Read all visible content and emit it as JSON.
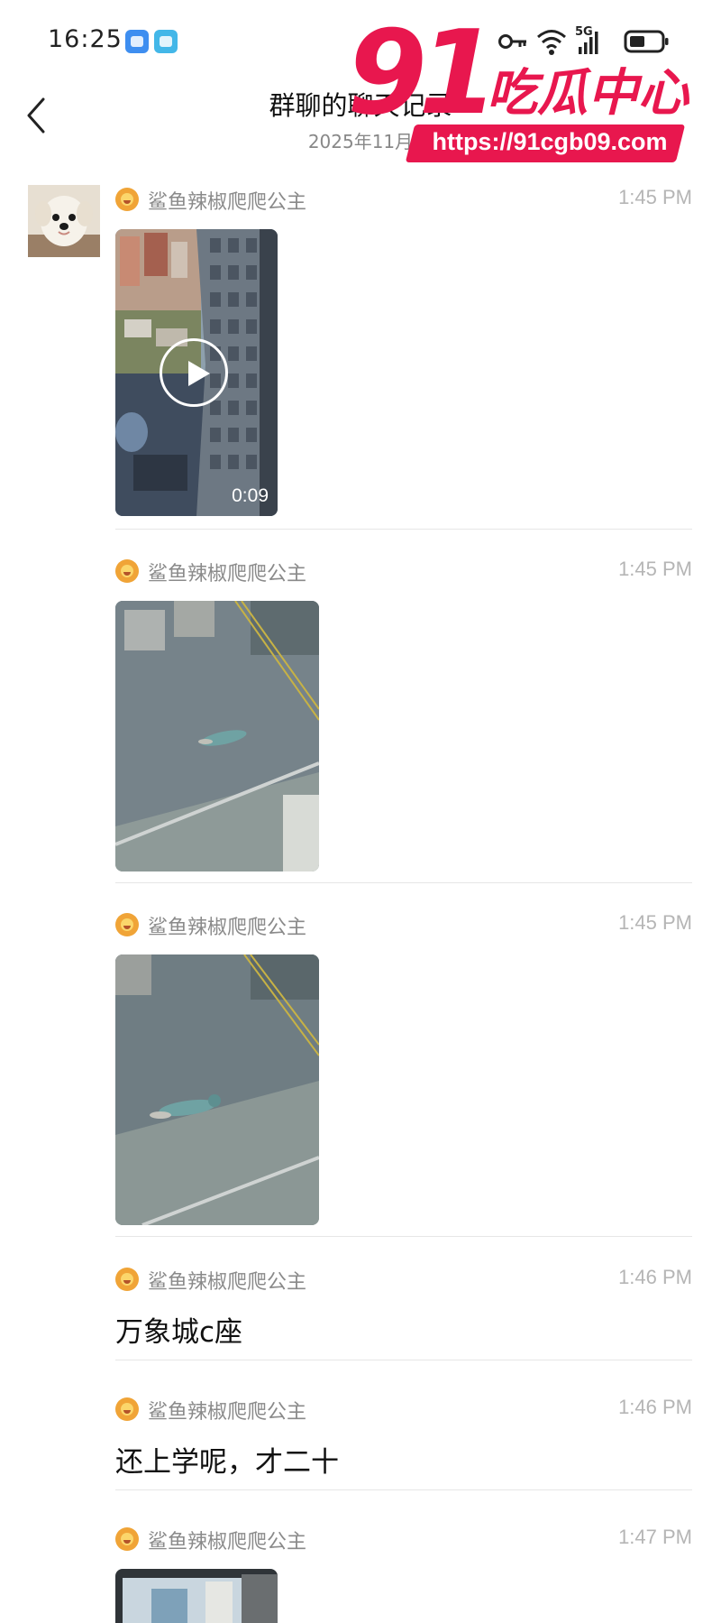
{
  "status_bar": {
    "time": "16:25",
    "network": "5G"
  },
  "header": {
    "title": "群聊的聊天记录",
    "date": "2025年11月"
  },
  "watermark": {
    "brand_number": "91",
    "brand_text": "吃瓜中心",
    "url": "https://91cgb09.com"
  },
  "icons": {
    "back": "chevron-left-icon",
    "key": "key-icon",
    "wifi": "wifi-icon",
    "signal": "signal-icon",
    "battery": "battery-icon",
    "play": "play-icon"
  },
  "colors": {
    "watermark": "#e8174e",
    "time_text": "#b5b5b5",
    "sender_text": "#8a8a8a"
  },
  "messages": [
    {
      "sender": "鲨鱼辣椒爬爬公主",
      "time": "1:45 PM",
      "type": "video",
      "duration": "0:09"
    },
    {
      "sender": "鲨鱼辣椒爬爬公主",
      "time": "1:45 PM",
      "type": "image"
    },
    {
      "sender": "鲨鱼辣椒爬爬公主",
      "time": "1:45 PM",
      "type": "image"
    },
    {
      "sender": "鲨鱼辣椒爬爬公主",
      "time": "1:46 PM",
      "type": "text",
      "text": "万象城c座"
    },
    {
      "sender": "鲨鱼辣椒爬爬公主",
      "time": "1:46 PM",
      "type": "text",
      "text": "还上学呢，才二十"
    },
    {
      "sender": "鲨鱼辣椒爬爬公主",
      "time": "1:47 PM",
      "type": "image"
    }
  ]
}
